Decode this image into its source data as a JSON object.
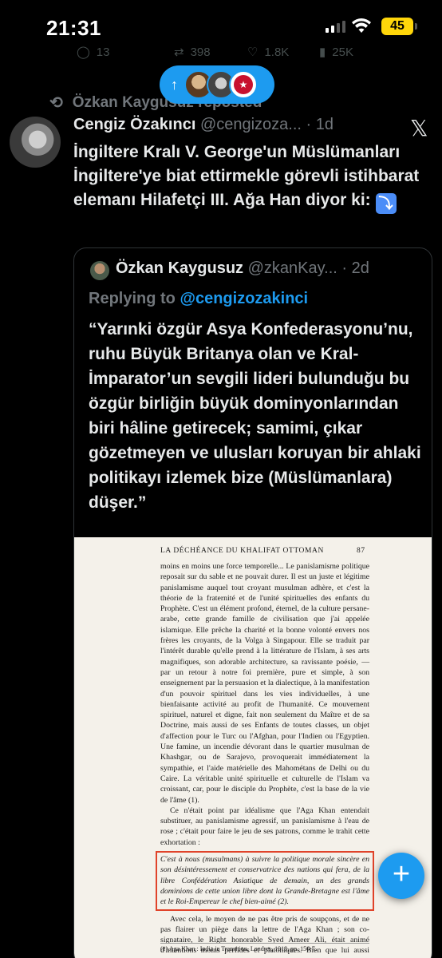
{
  "status": {
    "time": "21:31",
    "battery": "45"
  },
  "prev_actions": {
    "replies": "13",
    "reposts": "398",
    "likes": "1.8K",
    "views": "25K"
  },
  "new_posts_pill": {
    "arrow": "↑"
  },
  "repost_line": {
    "text": "Özkan Kaygusuz reposted"
  },
  "tweet": {
    "name": "Cengiz Özakıncı",
    "handle": "@cengizoza...",
    "time": "· 1d",
    "text": "İngiltere Kralı V. George'un Müslümanları İngiltere'ye biat ettirmekle görevli istihbarat elemanı Hilafetçi III. Ağa Han diyor ki:"
  },
  "quote": {
    "name": "Özkan Kaygusuz",
    "handle": "@zkanKay...",
    "time": "· 2d",
    "replying_label": "Replying to",
    "replying_mention": "@cengizozakinci",
    "text": "“Yarınki özgür Asya Konfederasyonu’nu, ruhu Büyük Britanya olan ve Kral-İmparator’un sevgili lideri bulunduğu bu özgür birliğin büyük dominyonlarından biri hâline getirecek; samimi, çıkar gözetmeyen ve ulusları koruyan bir ahlaki politikayı izlemek bize (Müslümanlara) düşer.”"
  },
  "book_page": {
    "header": "LA DÉCHÉANCE DU KHALIFAT OTTOMAN",
    "page_number": "87",
    "para1": "moins en moins une force temporelle... Le panislamisme politique reposait sur du sable et ne pouvait durer. Il est un juste et légitime panislamisme auquel tout croyant musulman adhère, et c'est la théorie de la fraternité et de l'unité spirituelles des enfants du Prophète. C'est un élément profond, éternel, de la culture persane-arabe, cette grande famille de civilisation que j'ai appelée islamique. Elle prêche la charité et la bonne volonté envers nos frères les croyants, de la Volga à Singapour. Elle se traduit par l'intérêt durable qu'elle prend à la littérature de l'Islam, à ses arts magnifiques, son adorable architecture, sa ravissante poésie, — par un retour à notre foi première, pure et simple, à son enseignement par la persuasion et la dialectique, à la manifestation d'un pouvoir spirituel dans les vies individuelles, à une bienfaisante activité au profit de l'humanité. Ce mouvement spirituel, naturel et digne, fait non seulement du Maître et de sa Doctrine, mais aussi de ses Enfants de toutes classes, un objet d'affection pour le Turc ou l'Afghan, pour l'Indien ou l'Egyptien. Une famine, un incendie dévorant dans le quartier musulman de Khashgar, ou de Sarajevo, provoquerait immédiatement la sympathie, et l'aide matérielle des Mahométans de Delhi ou du Caire. La véritable unité spirituelle et culturelle de l'Islam va croissant, car, pour le disciple du Prophète, c'est la base de la vie de l'âme (1).",
    "para2": "Ce n'était point par idéalisme que l'Aga Khan entendait substituer, au panislamisme agressif, un panislamisme à l'eau de rose ; c'était pour faire le jeu de ses patrons, comme le trahit cette exhortation :",
    "boxed": "C'est à nous (musulmans) à suivre la politique morale sincère en son désintéressement et conservatrice des nations qui fera, de la libre Confédération Asiatique de demain, un des grands dominions de cette union libre dont la Grande-Bretagne est l'âme et le Roi-Empereur le chef bien-aimé (2).",
    "para3": "Avec cela, le moyen de ne pas être pris de soupçons, et de ne pas flairer un piège dans la lettre de l'Aga Khan ; son co-signataire, le Right honorable Syed Ameer Ali, était animé d'intentions moins perfides et platoniques. Bien que lui aussi chargé d'honneurs anglo-indiens (P.C. LLD.",
    "footnote": "(1) Aga Khan : India in Transition, Londres, 1918, pp. 156-7."
  },
  "fab": {
    "label": "+"
  }
}
